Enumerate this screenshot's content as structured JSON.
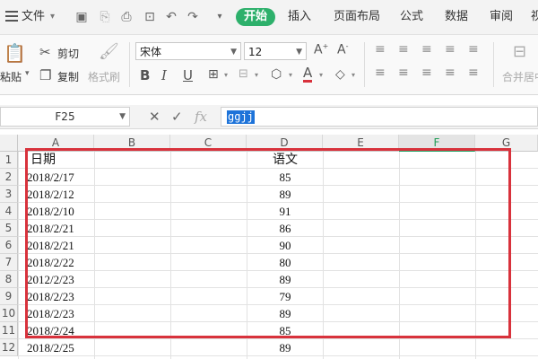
{
  "menubar": {
    "file_label": "文件",
    "start_tab": "开始",
    "tabs": [
      "插入",
      "页面布局",
      "公式",
      "数据",
      "审阅",
      "视"
    ]
  },
  "ribbon": {
    "paste_label": "粘贴",
    "cut_label": "剪切",
    "copy_label": "复制",
    "format_painter_label": "格式刷",
    "font_name": "宋体",
    "font_size": "12",
    "merge_label": "合并居中"
  },
  "formula_bar": {
    "cell_ref": "F25",
    "fx_label": "fx",
    "value": "ggjj"
  },
  "grid": {
    "columns": [
      "A",
      "B",
      "C",
      "D",
      "E",
      "F",
      "G"
    ],
    "active_column": "F",
    "rows": [
      "1",
      "2",
      "3",
      "4",
      "5",
      "6",
      "7",
      "8",
      "9",
      "10",
      "11",
      "12"
    ],
    "header_date": "日期",
    "header_score": "语文",
    "dates": [
      "2018/2/17",
      "2018/2/12",
      "2018/2/10",
      "2018/2/21",
      "2018/2/21",
      "2018/2/22",
      "2012/2/23",
      "2018/2/23",
      "2018/2/23",
      "2018/2/24",
      "2018/2/25"
    ],
    "scores": [
      "85",
      "89",
      "91",
      "86",
      "90",
      "80",
      "89",
      "79",
      "89",
      "85",
      "89"
    ]
  },
  "colors": {
    "accent": "#2db06b",
    "highlight_box": "#d8323c",
    "selection": "#1d73d9"
  }
}
